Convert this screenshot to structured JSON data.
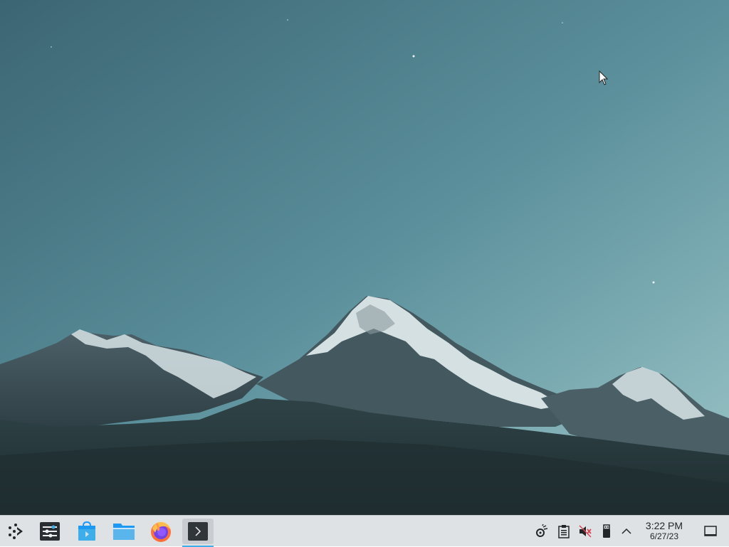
{
  "desktop": {
    "wallpaper": "mountain-landscape",
    "sky_color": "#4f8390",
    "cursor": "arrow-cursor"
  },
  "taskbar": {
    "launcher": {
      "icon": "application-launcher-icon"
    },
    "pinned_apps": [
      {
        "icon": "system-settings-icon"
      },
      {
        "icon": "discover-store-icon"
      },
      {
        "icon": "dolphin-file-manager-icon"
      },
      {
        "icon": "firefox-icon"
      },
      {
        "icon": "konsole-terminal-icon"
      }
    ],
    "system_tray": [
      {
        "icon": "kde-connect-icon"
      },
      {
        "icon": "clipboard-icon"
      },
      {
        "icon": "volume-muted-icon"
      },
      {
        "icon": "usb-device-icon"
      },
      {
        "icon": "show-hidden-icons-chevron"
      }
    ],
    "clock": {
      "time": "3:22 PM",
      "date": "6/27/23"
    },
    "show_desktop": {
      "icon": "show-desktop-icon"
    },
    "accent_color": "#3daee9",
    "panel_color": "#dfe2e5"
  }
}
